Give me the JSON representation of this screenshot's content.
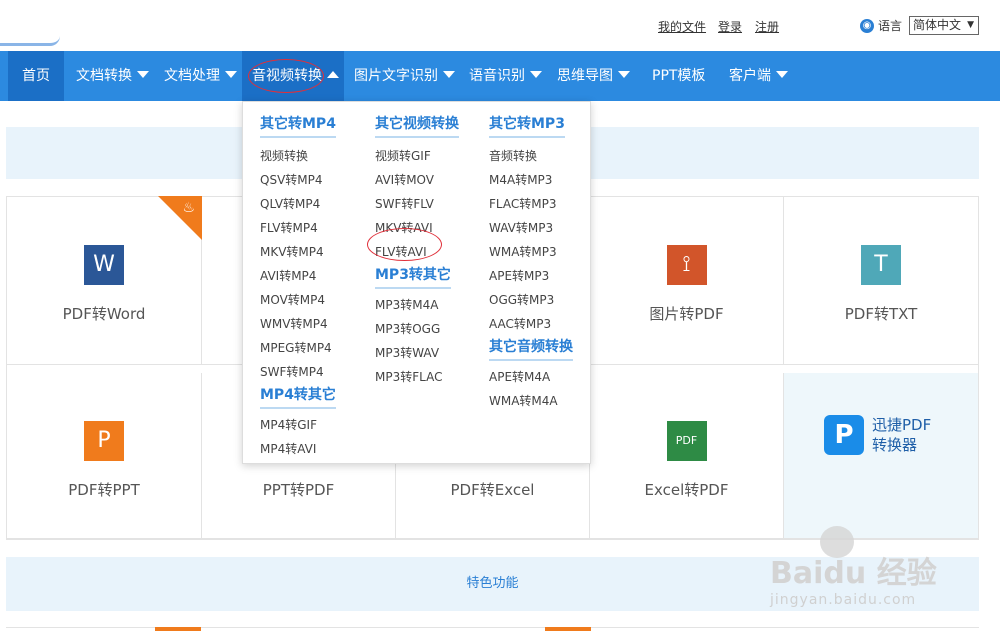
{
  "header": {
    "links": {
      "my_files": "我的文件",
      "login": "登录",
      "register": "注册"
    },
    "language_label": "语言",
    "language_value": "简体中文"
  },
  "nav": {
    "items": [
      {
        "label": "首页",
        "has_dropdown": false
      },
      {
        "label": "文档转换",
        "has_dropdown": true
      },
      {
        "label": "文档处理",
        "has_dropdown": true
      },
      {
        "label": "音视频转换",
        "has_dropdown": true,
        "active": true
      },
      {
        "label": "图片文字识别",
        "has_dropdown": true
      },
      {
        "label": "语音识别",
        "has_dropdown": true
      },
      {
        "label": "思维导图",
        "has_dropdown": true
      },
      {
        "label": "PPT模板",
        "has_dropdown": false
      },
      {
        "label": "客户端",
        "has_dropdown": true
      }
    ]
  },
  "dropdown": {
    "col1": {
      "heading": "其它转MP4",
      "items": [
        "视频转换",
        "QSV转MP4",
        "QLV转MP4",
        "FLV转MP4",
        "MKV转MP4",
        "AVI转MP4",
        "MOV转MP4",
        "WMV转MP4",
        "MPEG转MP4",
        "SWF转MP4"
      ],
      "heading2": "MP4转其它",
      "items2": [
        "MP4转GIF",
        "MP4转AVI"
      ]
    },
    "col2": {
      "heading": "其它视频转换",
      "items": [
        "视频转GIF",
        "AVI转MOV",
        "SWF转FLV",
        "MKV转AVI",
        "FLV转AVI"
      ],
      "heading2": "MP3转其它",
      "items2": [
        "MP3转M4A",
        "MP3转OGG",
        "MP3转WAV",
        "MP3转FLAC"
      ]
    },
    "col3": {
      "heading": "其它转MP3",
      "items": [
        "音频转换",
        "M4A转MP3",
        "FLAC转MP3",
        "WAV转MP3",
        "WMA转MP3",
        "APE转MP3",
        "OGG转MP3",
        "AAC转MP3"
      ],
      "heading2": "其它音频转换",
      "items2": [
        "APE转M4A",
        "WMA转M4A"
      ]
    }
  },
  "tiles": {
    "pdf_to_word": {
      "label": "PDF转Word",
      "icon": "W",
      "color": "#2b5797"
    },
    "image_to_pdf": {
      "label": "图片转PDF",
      "color": "#d2552a"
    },
    "pdf_to_txt": {
      "label": "PDF转TXT",
      "icon": "T",
      "color": "#4fa8b8"
    },
    "pdf_to_ppt": {
      "label": "PDF转PPT",
      "icon": "P",
      "color": "#f07b1c"
    },
    "ppt_to_pdf": {
      "label": "PPT转PDF"
    },
    "pdf_to_excel": {
      "label": "PDF转Excel"
    },
    "excel_to_pdf": {
      "label": "Excel转PDF",
      "color": "#2e8b45"
    },
    "xunjie": {
      "line1": "迅捷PDF",
      "line2": "转换器"
    }
  },
  "feature_bar": "特色功能",
  "watermark": {
    "brand": "Bai",
    "brand2": "du",
    "brand3": "经验",
    "url": "jingyan.baidu.com"
  }
}
